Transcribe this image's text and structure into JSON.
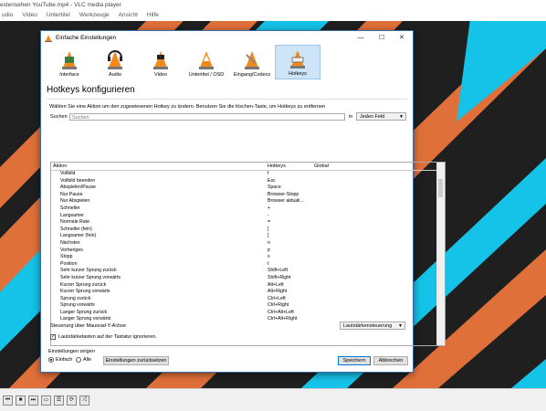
{
  "window": {
    "title": "estensehen YouTube.mp4 - VLC media player"
  },
  "menubar": [
    "udio",
    "Video",
    "Untertitel",
    "Werkzeuge",
    "Ansicht",
    "Hilfe"
  ],
  "dialog": {
    "title": "Einfache Einstellungen",
    "categories": [
      {
        "label": "Interface",
        "icon": "interface-icon"
      },
      {
        "label": "Audio",
        "icon": "audio-icon"
      },
      {
        "label": "Video",
        "icon": "video-icon"
      },
      {
        "label": "Untertitel / OSD",
        "icon": "subtitles-icon"
      },
      {
        "label": "Eingang/Codecs",
        "icon": "input-codecs-icon"
      },
      {
        "label": "Hotkeys",
        "icon": "hotkeys-icon"
      }
    ],
    "heading": "Hotkeys konfigurieren",
    "help_text": "Wählen Sie eine Aktion um den zugewiesenen Hotkey zu ändern. Benutzen Sie die löschen-Taste, um Hotkeys zu entfernen",
    "search": {
      "label": "Suchen",
      "placeholder": "Suchen",
      "in_label": "in",
      "field_value": "Jeden Feld"
    },
    "table": {
      "headers": [
        "Aktion",
        "Hotkeys",
        "Global"
      ],
      "rows": [
        [
          "Vollbild",
          "f"
        ],
        [
          "Vollbild beenden",
          "Esc"
        ],
        [
          "Abspielen/Pause",
          "Space"
        ],
        [
          "Nur Pause",
          "Browser-Stopp"
        ],
        [
          "Nur Abspielen",
          "Browser aktuali..."
        ],
        [
          "Schneller",
          "+"
        ],
        [
          "Langsamer",
          "-"
        ],
        [
          "Normale Rate",
          "="
        ],
        [
          "Schneller (fein)",
          "]"
        ],
        [
          "Langsamer (fein)",
          "["
        ],
        [
          "Nächstes",
          "n"
        ],
        [
          "Vorheriges",
          "p"
        ],
        [
          "Stopp",
          "s"
        ],
        [
          "Position",
          "t"
        ],
        [
          "Sehr kurzer Sprung zurück",
          "Shift+Left"
        ],
        [
          "Sehr kurzer Sprung vorwärts",
          "Shift+Right"
        ],
        [
          "Kurzer Sprung zurück",
          "Alt+Left"
        ],
        [
          "Kurzer Sprung vorwärts",
          "Alt+Right"
        ],
        [
          "Sprung zurück",
          "Ctrl+Left"
        ],
        [
          "Sprung vorwärts",
          "Ctrl+Right"
        ],
        [
          "Langer Sprung zurück",
          "Ctrl+Alt+Left"
        ],
        [
          "Langer Sprung vorwärts",
          "Ctrl+Alt+Right"
        ]
      ]
    },
    "mouse_wheel": {
      "label": "Steuerung über Mausrad-Y-Achse",
      "value": "Lautstärkensteuerung"
    },
    "ignore_volume": {
      "label": "Lautstärketasten auf der Tastatur ignorieren.",
      "checked": true
    },
    "show_settings": {
      "label": "Einstellungen zeigen",
      "simple": "Einfach",
      "all": "Alle",
      "selected": "Einfach"
    },
    "reset_button": "Einstellungen zurücksetzen",
    "save_button": "Speichern",
    "cancel_button": "Abbrechen"
  },
  "colors": {
    "stripe_orange": "#e0703a",
    "stripe_cyan": "#16c3e8",
    "background": "#1f1f1f",
    "selection": "#cde4f7"
  }
}
